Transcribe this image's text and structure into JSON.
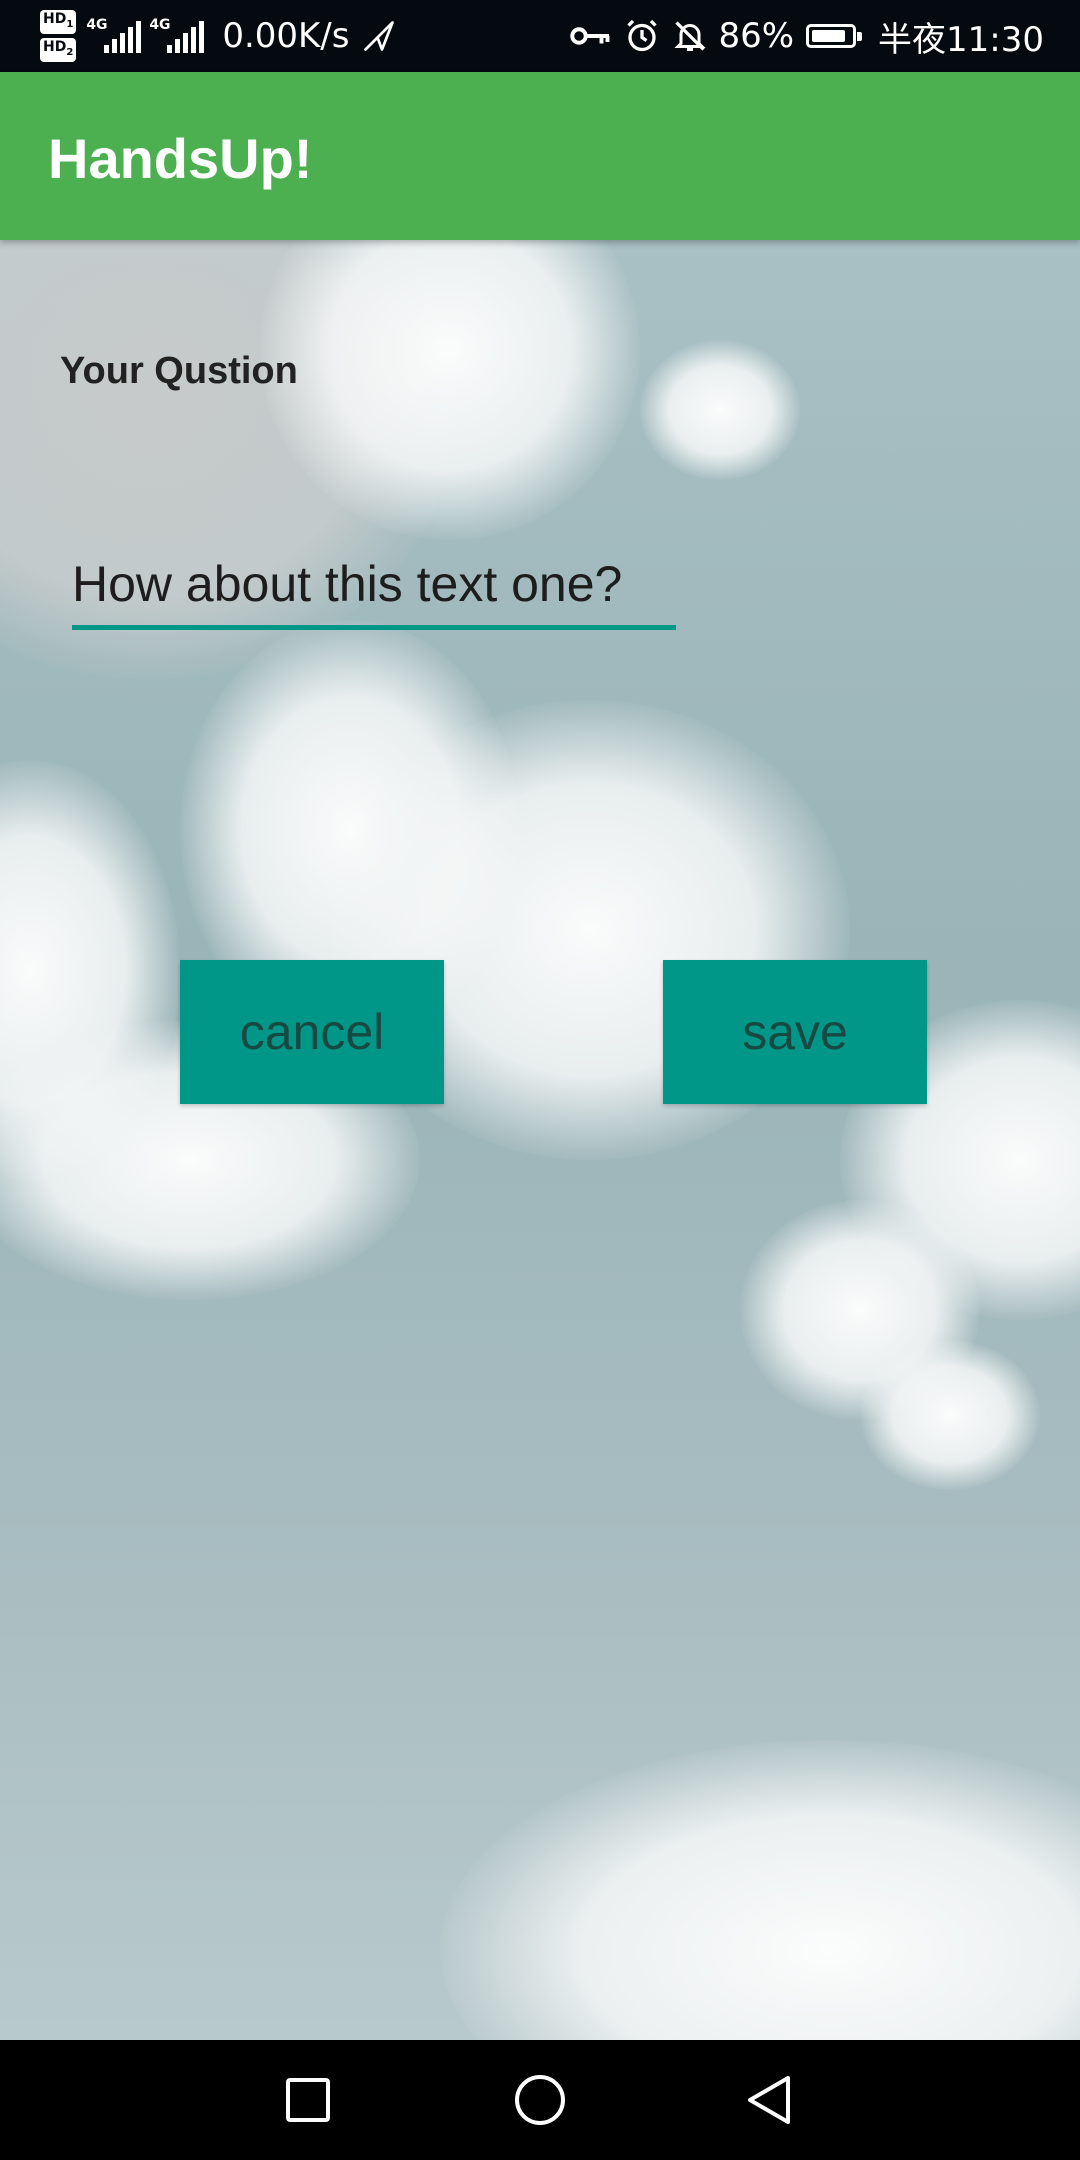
{
  "status_bar": {
    "hd1": "HD",
    "hd2": "HD",
    "hd1_sub": "1",
    "hd2_sub": "2",
    "net1": "4G",
    "net2": "4G",
    "speed": "0.00K/s",
    "battery_pct": "86%",
    "battery_level": 0.86,
    "time": "半夜11:30",
    "icons": [
      "send-icon",
      "key-icon",
      "alarm-icon",
      "bell-off-icon",
      "battery-icon"
    ]
  },
  "app_bar": {
    "title": "HandsUp!",
    "color": "#4caf50"
  },
  "form": {
    "question_label": "Your Qustion",
    "question_value": "How about this text one?",
    "accent_color": "#009688"
  },
  "buttons": {
    "cancel": "cancel",
    "save": "save"
  },
  "nav_bar": {
    "icons": [
      "recents-square-icon",
      "home-circle-icon",
      "back-triangle-icon"
    ]
  }
}
